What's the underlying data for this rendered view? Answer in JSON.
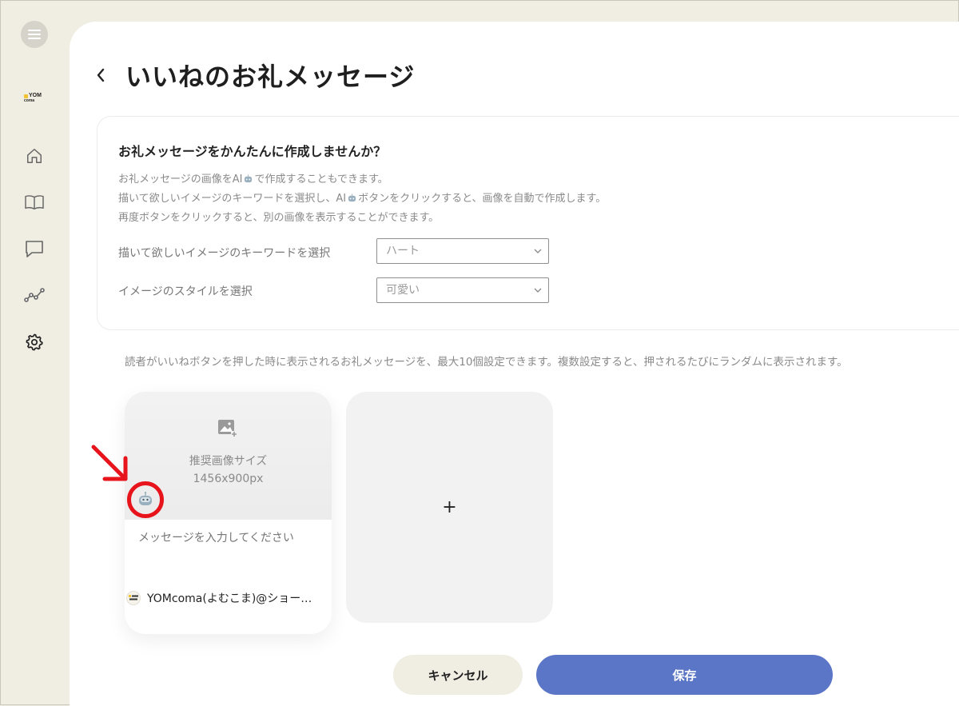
{
  "sidebar": {
    "logo": {
      "top": "YOM",
      "bottom": "coma"
    },
    "items": [
      {
        "icon": "home-icon"
      },
      {
        "icon": "book-icon"
      },
      {
        "icon": "comment-icon"
      },
      {
        "icon": "analytics-icon"
      },
      {
        "icon": "gear-icon"
      }
    ]
  },
  "header": {
    "title": "いいねのお礼メッセージ"
  },
  "generator": {
    "title": "お礼メッセージをかんたんに作成しませんか？",
    "desc1_a": "お礼メッセージの画像をAI",
    "desc1_b": "で作成することもできます。",
    "desc2_a": "描いて欲しいイメージのキーワードを選択し、AI",
    "desc2_b": "ボタンをクリックすると、画像を自動で作成します。",
    "desc3": "再度ボタンをクリックすると、別の画像を表示することができます。",
    "keyword_label": "描いて欲しいイメージのキーワードを選択",
    "keyword_value": "ハート",
    "style_label": "イメージのスタイルを選択",
    "style_value": "可愛い"
  },
  "notice": "読者がいいねボタンを押した時に表示されるお礼メッセージを、最大10個設定できます。複数設定すると、押されるたびにランダムに表示されます。",
  "message_card": {
    "size_label": "推奨画像サイズ",
    "size_value": "1456x900px",
    "input_placeholder": "メッセージを入力してください",
    "author": "YOMcoma(よむこま)@ショートマンガ"
  },
  "add_card": {
    "symbol": "+"
  },
  "buttons": {
    "cancel": "キャンセル",
    "save": "保存"
  },
  "colors": {
    "sidebar_bg": "#f0ede2",
    "save_button": "#5b76c6",
    "annotation": "#e8141b"
  }
}
